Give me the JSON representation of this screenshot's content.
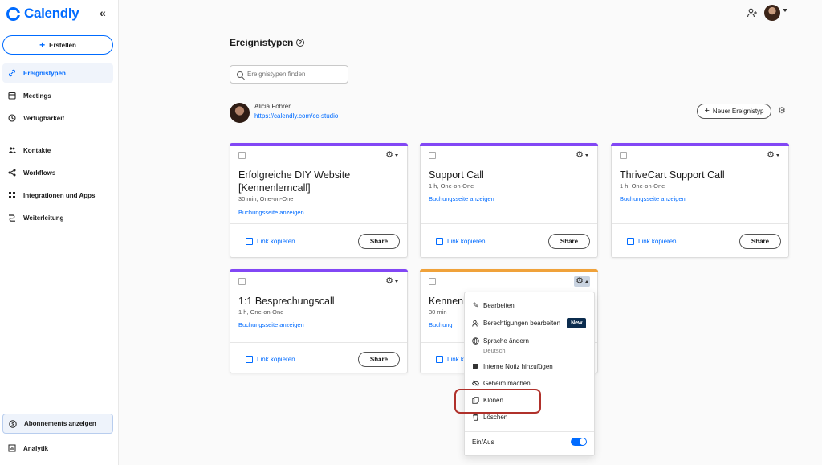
{
  "brand": {
    "name": "Calendly",
    "color": "#006bff"
  },
  "sidebar": {
    "collapse_icon": "double-chevron-left-icon",
    "create_label": "Erstellen",
    "items": [
      {
        "label": "Ereignistypen",
        "icon": "link-icon",
        "active": true
      },
      {
        "label": "Meetings",
        "icon": "calendar-icon"
      },
      {
        "label": "Verfügbarkeit",
        "icon": "clock-icon"
      },
      {
        "label": "Kontakte",
        "icon": "contacts-icon"
      },
      {
        "label": "Workflows",
        "icon": "workflow-icon"
      },
      {
        "label": "Integrationen und Apps",
        "icon": "apps-grid-icon"
      },
      {
        "label": "Weiterleitung",
        "icon": "routing-icon"
      }
    ],
    "bottom": [
      {
        "label": "Abonnements anzeigen",
        "icon": "dollar-icon"
      },
      {
        "label": "Analytik",
        "icon": "chart-icon"
      }
    ]
  },
  "header": {
    "add_user_icon": "add-user-icon",
    "avatar_icon": "avatar"
  },
  "main": {
    "title": "Ereignistypen",
    "search_placeholder": "Ereignistypen finden",
    "user": {
      "name": "Alicia Fohrer",
      "link": "https://calendly.com/cc-studio"
    },
    "new_type_label": "Neuer Ereignistyp",
    "cards": [
      {
        "name": "Erfolgreiche DIY Website [Kennenlerncall]",
        "meta": "30 min, One-on-One",
        "view": "Buchungsseite anzeigen",
        "copy": "Link kopieren",
        "share": "Share",
        "color": "#8247f5"
      },
      {
        "name": "Support Call",
        "meta": "1 h, One-on-One",
        "view": "Buchungsseite anzeigen",
        "copy": "Link kopieren",
        "share": "Share",
        "color": "#8247f5"
      },
      {
        "name": "ThriveCart Support Call",
        "meta": "1 h, One-on-One",
        "view": "Buchungsseite anzeigen",
        "copy": "Link kopieren",
        "share": "Share",
        "color": "#8247f5"
      },
      {
        "name": "1:1 Besprechungscall",
        "meta": "1 h, One-on-One",
        "view": "Buchungsseite anzeigen",
        "copy": "Link kopieren",
        "share": "Share",
        "color": "#8247f5"
      },
      {
        "name": "Kennenl",
        "meta": "30 min",
        "view": "Buchung",
        "copy": "Link k",
        "share": "",
        "color": "#f0a23a"
      }
    ]
  },
  "menu": {
    "items": [
      {
        "label": "Bearbeiten",
        "icon": "pencil-icon"
      },
      {
        "label": "Berechtigungen bearbeiten",
        "icon": "permissions-icon",
        "badge": "New"
      },
      {
        "label": "Sprache ändern",
        "sub": "Deutsch",
        "icon": "globe-icon"
      },
      {
        "label": "Interne Notiz hinzufügen",
        "icon": "note-icon"
      },
      {
        "label": "Geheim machen",
        "icon": "eye-off-icon"
      },
      {
        "label": "Klonen",
        "icon": "clone-icon"
      },
      {
        "label": "Löschen",
        "icon": "trash-icon"
      }
    ],
    "toggle_label": "Ein/Aus",
    "toggle_on": true
  },
  "annotation_color": "#b0312b"
}
